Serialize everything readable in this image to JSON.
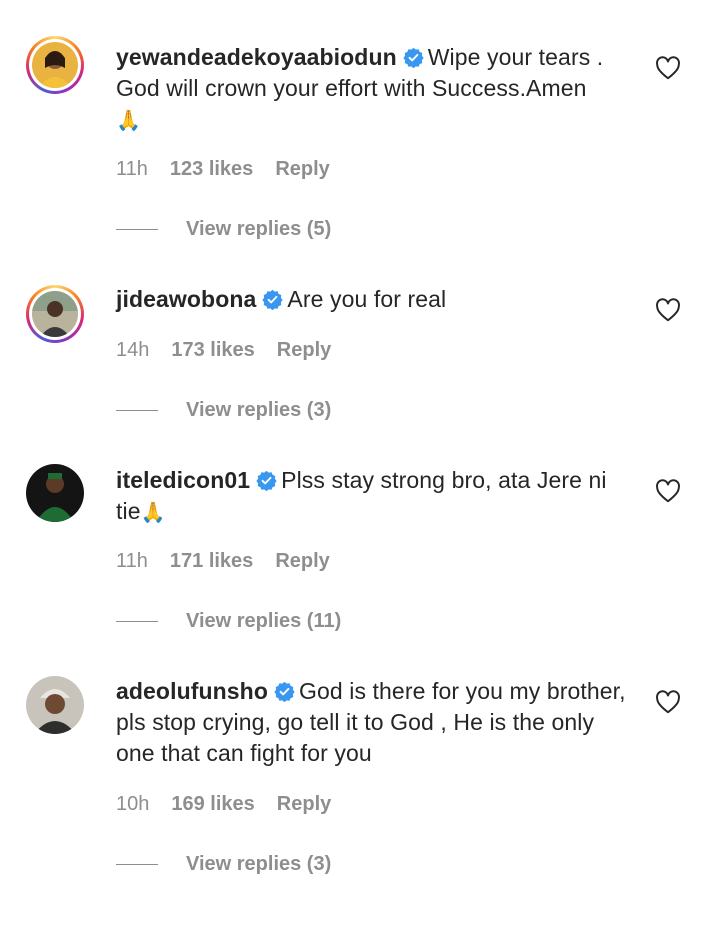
{
  "comments": [
    {
      "username": "yewandeadekoyaabiodun",
      "text": "Wipe your tears . God will crown your effort with Success.Amen",
      "emoji": "🙏",
      "time": "11h",
      "likes": "123 likes",
      "reply": "Reply",
      "view_replies": "View replies (5)",
      "story_ring": true,
      "avatar_color": "#e0a21a"
    },
    {
      "username": "jideawobona",
      "text": "Are you for real",
      "emoji": "",
      "time": "14h",
      "likes": "173 likes",
      "reply": "Reply",
      "view_replies": "View replies (3)",
      "story_ring": true,
      "avatar_color": "#6b7a5c"
    },
    {
      "username": "iteledicon01",
      "text": "Plss stay strong bro, ata Jere ni tie",
      "emoji": "🙏",
      "time": "11h",
      "likes": "171 likes",
      "reply": "Reply",
      "view_replies": "View replies (11)",
      "story_ring": false,
      "avatar_color": "#1f5a2e"
    },
    {
      "username": "adeolufunsho",
      "text": "God is there for you my brother, pls stop crying, go tell it to God , He is the only one that can fight for you",
      "emoji": "",
      "time": "10h",
      "likes": "169 likes",
      "reply": "Reply",
      "view_replies": "View replies (3)",
      "story_ring": false,
      "avatar_color": "#8a8478"
    }
  ],
  "colors": {
    "text": "#262626",
    "secondary": "#8e8e8e",
    "verified": "#3897f0"
  },
  "icons": {
    "verified": "verified-badge-icon",
    "like": "heart-outline-icon"
  }
}
